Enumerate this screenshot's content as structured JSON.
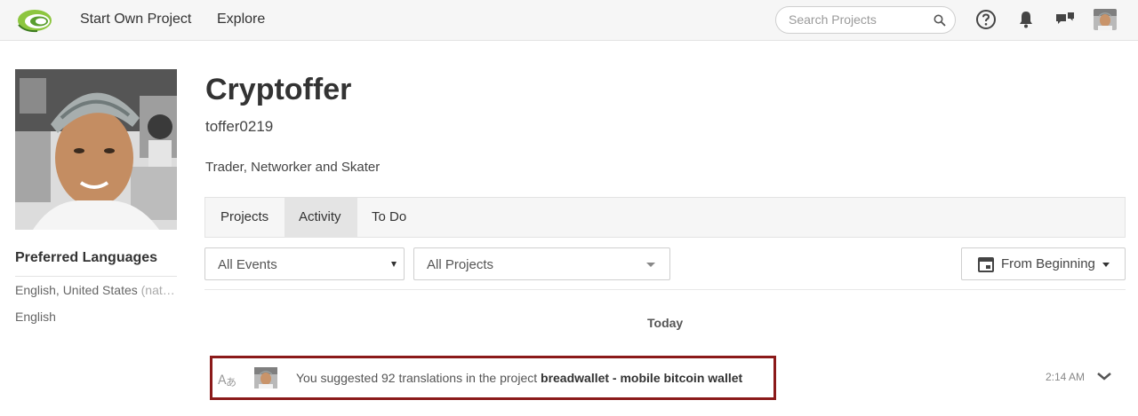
{
  "header": {
    "nav": {
      "start_project": "Start Own Project",
      "explore": "Explore"
    },
    "search": {
      "placeholder": "Search Projects"
    },
    "icons": [
      "help-icon",
      "bell-icon",
      "chat-icon"
    ],
    "colors": {
      "logo_green": "#8dc63f",
      "topbar_bg": "#f6f6f6"
    }
  },
  "sidebar": {
    "preferred_languages_title": "Preferred Languages",
    "languages": [
      {
        "name": "English, United States",
        "note": "(nat…"
      },
      {
        "name": "English",
        "note": ""
      }
    ]
  },
  "profile": {
    "display_name": "Cryptoffer",
    "username": "toffer0219",
    "bio": "Trader, Networker and Skater"
  },
  "tabs": [
    {
      "label": "Projects",
      "active": false
    },
    {
      "label": "Activity",
      "active": true
    },
    {
      "label": "To Do",
      "active": false
    }
  ],
  "filters": {
    "events": "All Events",
    "projects": "All Projects",
    "date_range": "From Beginning"
  },
  "activity": {
    "day_label": "Today",
    "items": [
      {
        "text_prefix": "You suggested 92 translations in the project ",
        "project": "breadwallet - mobile bitcoin wallet",
        "time": "2:14 AM",
        "highlight_color": "#8b1a1a"
      }
    ]
  }
}
